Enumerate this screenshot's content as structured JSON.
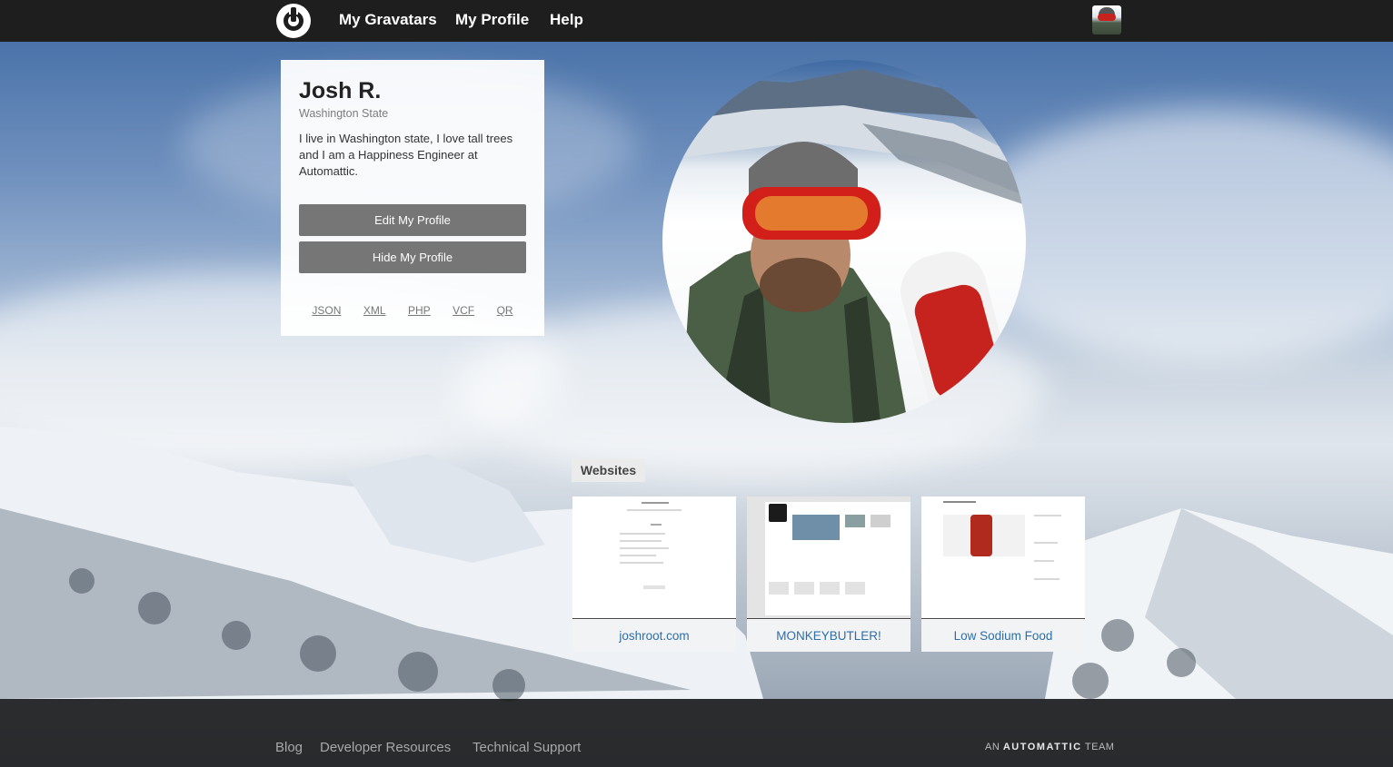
{
  "nav": {
    "logo": "gravatar-logo",
    "links": [
      "My Gravatars",
      "My Profile",
      "Help"
    ]
  },
  "profile": {
    "name": "Josh R.",
    "location": "Washington State",
    "bio": "I live in Washington state, I love tall trees and I am a Happiness Engineer at Automattic.",
    "buttons": {
      "edit": "Edit My Profile",
      "hide": "Hide My Profile"
    },
    "formats": [
      "JSON",
      "XML",
      "PHP",
      "VCF",
      "QR"
    ]
  },
  "websites": {
    "label": "Websites",
    "items": [
      {
        "title": "joshroot.com"
      },
      {
        "title": "MONKEYBUTLER!"
      },
      {
        "title": "Low Sodium Food"
      }
    ]
  },
  "footer": {
    "links": [
      "Blog",
      "Developer Resources",
      "Technical Support"
    ],
    "tagline_prefix": "AN",
    "tagline_brand": "AUTOMATTIC",
    "tagline_suffix": "TEAM"
  },
  "colors": {
    "nav_bg": "#1e1e1e",
    "button_bg": "#767676",
    "link": "#2f6ea8"
  }
}
